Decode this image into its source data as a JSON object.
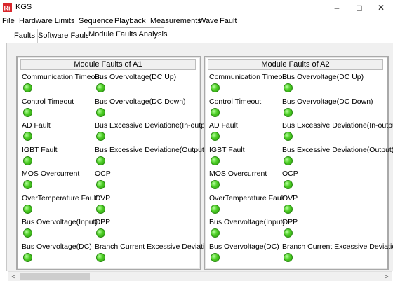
{
  "window": {
    "title": "KGS",
    "minimize": "–",
    "maximize": "□",
    "close": "✕"
  },
  "menu": [
    "File",
    "Hardware Limits",
    "Sequence",
    "Playback",
    "Measurements",
    "Wave",
    "Fault"
  ],
  "tabs": [
    "Faults",
    "Software Fauls",
    "Module Faults Analysis"
  ],
  "active_tab": "Module Faults Analysis",
  "panels": [
    {
      "title": "Module Faults of A1",
      "left": [
        "Communication Timeout",
        "Control Timeout",
        "AD Fault",
        "IGBT Fault",
        "MOS Overcurrent",
        "OverTemperature Fault",
        "Bus Overvoltage(Input)",
        "Bus Overvoltage(DC)"
      ],
      "right": [
        "Bus Overvoltage(DC Up)",
        "Bus Overvoltage(DC Down)",
        "Bus Excessive Deviatione(In-output)",
        "Bus Excessive Deviatione(Output)",
        "OCP",
        "OVP",
        "OPP",
        "Branch Current Excessive Deviatione"
      ]
    },
    {
      "title": "Module Faults of A2",
      "left": [
        "Communication Timeout",
        "Control Timeout",
        "AD Fault",
        "IGBT Fault",
        "MOS Overcurrent",
        "OverTemperature Fault",
        "Bus Overvoltage(Input)",
        "Bus Overvoltage(DC)"
      ],
      "right": [
        "Bus Overvoltage(DC Up)",
        "Bus Overvoltage(DC Down)",
        "Bus Excessive Deviatione(In-output)",
        "Bus Excessive Deviatione(Output)",
        "OCP",
        "OVP",
        "OPP",
        "Branch Current Excessive Deviatione"
      ]
    }
  ],
  "indicator_status": "ok",
  "indicator_color": "#4ccd24",
  "scrollbar": {
    "left_arrow": "<",
    "right_arrow": ">"
  }
}
